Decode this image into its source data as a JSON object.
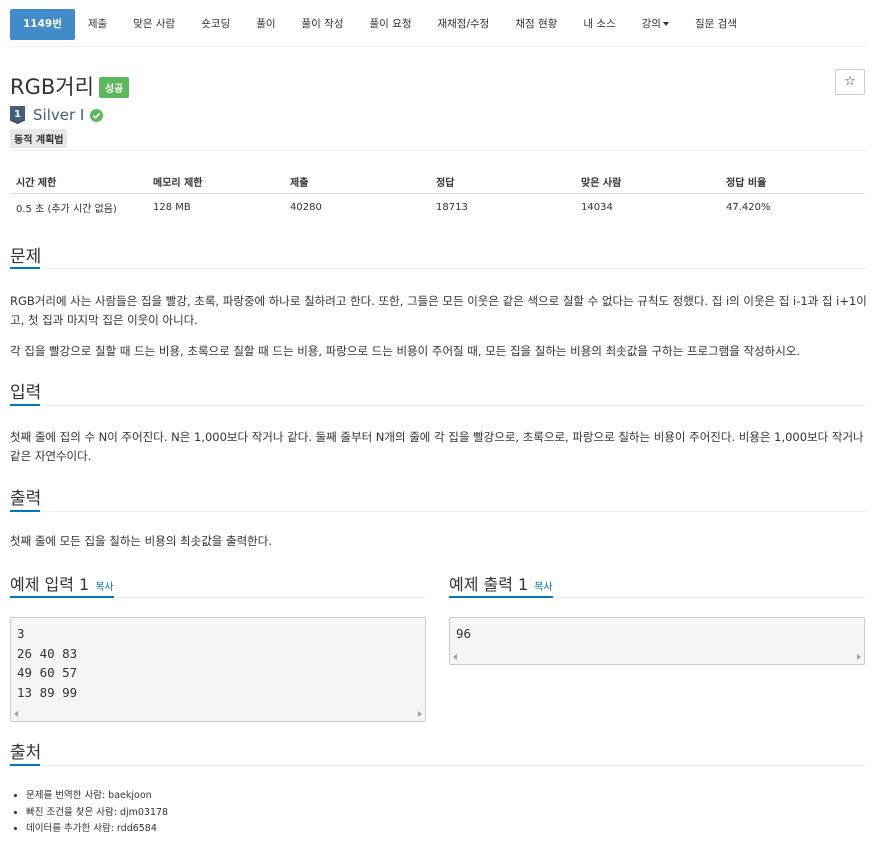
{
  "nav": {
    "items": [
      {
        "label": "1149번",
        "active": true
      },
      {
        "label": "제출"
      },
      {
        "label": "맞은 사람"
      },
      {
        "label": "숏코딩"
      },
      {
        "label": "풀이"
      },
      {
        "label": "풀이 작성"
      },
      {
        "label": "풀이 요청"
      },
      {
        "label": "재채점/수정"
      },
      {
        "label": "채점 현황"
      },
      {
        "label": "내 소스"
      },
      {
        "label": "강의",
        "dropdown": true
      },
      {
        "label": "질문 검색"
      }
    ]
  },
  "problem": {
    "title": "RGB거리",
    "status_badge": "성공",
    "star_icon": "star-icon",
    "tier": {
      "level": "1",
      "label": "Silver I",
      "verified_icon": "check-circle-icon"
    },
    "tag": "동적 계획법"
  },
  "stats": {
    "headers": [
      "시간 제한",
      "메모리 제한",
      "제출",
      "정답",
      "맞은 사람",
      "정답 비율"
    ],
    "values": [
      "0.5 초 (추가 시간 없음)",
      "128 MB",
      "40280",
      "18713",
      "14034",
      "47.420%"
    ]
  },
  "sections": {
    "problem": {
      "heading": "문제",
      "p1": "RGB거리에 사는 사람들은 집을 빨강, 초록, 파랑중에 하나로 칠하려고 한다. 또한, 그들은 모든 이웃은 같은 색으로 칠할 수 없다는 규칙도 정했다. 집 i의 이웃은 집 i-1과 집 i+1이고, 첫 집과 마지막 집은 이웃이 아니다.",
      "p2": "각 집을 빨강으로 칠할 때 드는 비용, 초록으로 칠할 때 드는 비용, 파랑으로 드는 비용이 주어질 때, 모든 집을 칠하는 비용의 최솟값을 구하는 프로그램을 작성하시오."
    },
    "input": {
      "heading": "입력",
      "p1": "첫째 줄에 집의 수 N이 주어진다. N은 1,000보다 작거나 같다. 둘째 줄부터 N개의 줄에 각 집을 빨강으로, 초록으로, 파랑으로 칠하는 비용이 주어진다. 비용은 1,000보다 작거나 같은 자연수이다."
    },
    "output": {
      "heading": "출력",
      "p1": "첫째 줄에 모든 집을 칠하는 비용의 최솟값을 출력한다."
    },
    "sample_input": {
      "heading": "예제 입력 1",
      "copy": "복사",
      "lines": "3\n26 40 83\n49 60 57\n13 89 99"
    },
    "sample_output": {
      "heading": "예제 출력 1",
      "copy": "복사",
      "lines": "96"
    },
    "source": {
      "heading": "출처",
      "items": [
        "문제를 번역한 사람: baekjoon",
        "빠진 조건을 찾은 사람: djm03178",
        "데이터를 추가한 사람: rdd6584"
      ]
    }
  },
  "colors": {
    "accent": "#428bca",
    "link": "#0076c0",
    "success": "#5cb85c",
    "tier": "#435f7a"
  }
}
